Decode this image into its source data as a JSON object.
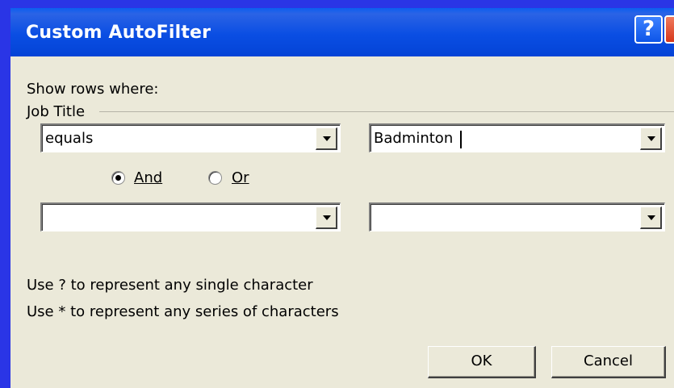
{
  "window": {
    "title": "Custom AutoFilter",
    "help_label": "?",
    "close_label": "✕"
  },
  "dialog": {
    "show_rows_label": "Show rows where:",
    "field_label": "Job Title",
    "condition1": {
      "operator": "equals",
      "value": "Badminton"
    },
    "condition2": {
      "operator": "",
      "value": ""
    },
    "logic": {
      "and_label": "And",
      "or_label": "Or",
      "selected": "And"
    },
    "hint1": "Use ? to represent any single character",
    "hint2": "Use * to represent any series of characters",
    "ok_label": "OK",
    "cancel_label": "Cancel"
  }
}
